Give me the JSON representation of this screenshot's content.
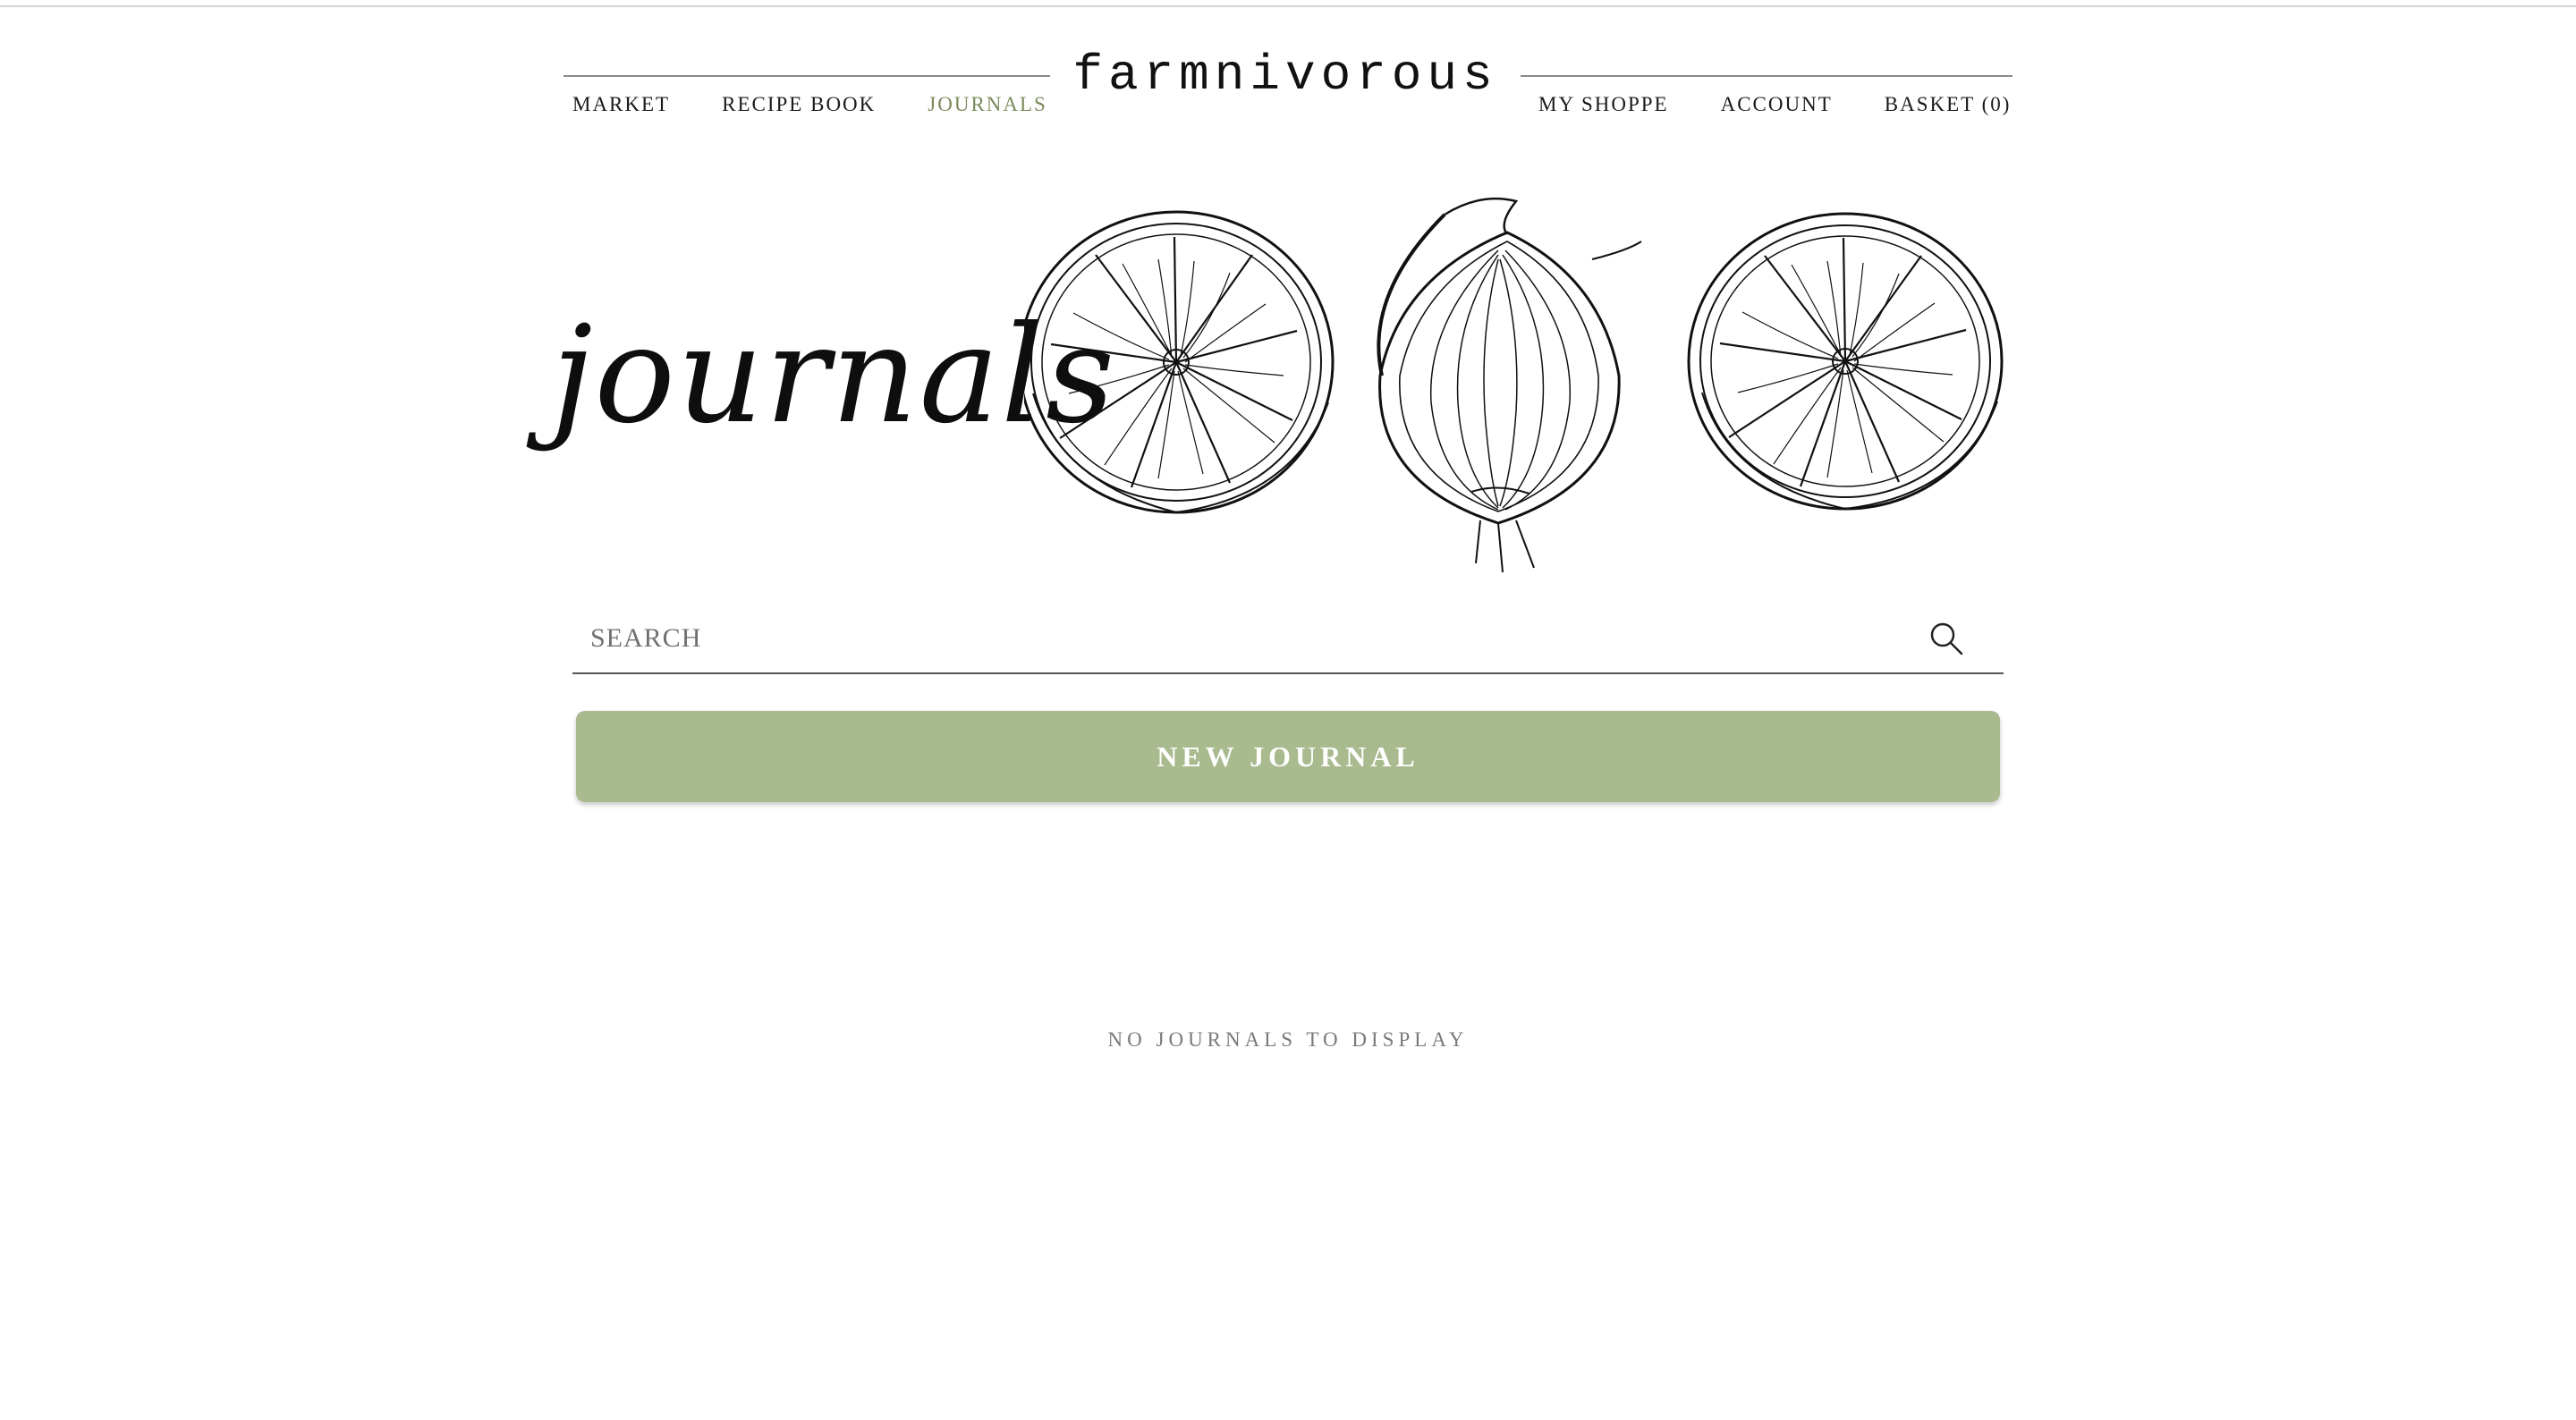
{
  "brand": {
    "logo": "farmnivorous"
  },
  "nav": {
    "left": [
      {
        "label": "MARKET",
        "active": false
      },
      {
        "label": "RECIPE BOOK",
        "active": false
      },
      {
        "label": "JOURNALS",
        "active": true
      }
    ],
    "right": [
      {
        "label": "MY SHOPPE"
      },
      {
        "label": "ACCOUNT"
      },
      {
        "label": "BASKET (0)"
      }
    ],
    "active_color": "#7b8a5c"
  },
  "hero": {
    "title": "journals",
    "illustrations": [
      "citrus-slice-illustration",
      "onion-half-illustration",
      "citrus-slice-illustration"
    ]
  },
  "search": {
    "placeholder": "SEARCH",
    "value": "",
    "icon": "search-icon"
  },
  "actions": {
    "new_journal_label": "NEW JOURNAL",
    "button_color": "#a9ba8e"
  },
  "journals": {
    "items": [],
    "empty_message": "NO JOURNALS TO DISPLAY"
  }
}
